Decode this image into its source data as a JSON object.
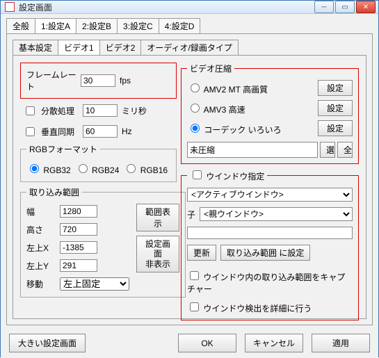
{
  "window": {
    "title": "設定画面"
  },
  "tabs1": {
    "items": [
      "全般",
      "1:設定A",
      "2:設定B",
      "3:設定C",
      "4:設定D"
    ],
    "active": 1
  },
  "tabs2": {
    "items": [
      "基本設定",
      "ビデオ1",
      "ビデオ2",
      "オーディオ/録画タイプ"
    ],
    "active": 1
  },
  "frame_rate": {
    "legend": "フレームレート",
    "value": "30",
    "unit": "fps",
    "distrib_label": "分散処理",
    "distrib_value": "10",
    "distrib_unit": "ミリ秒",
    "vsync_label": "垂直同期",
    "vsync_value": "60",
    "vsync_unit": "Hz"
  },
  "rgb_format": {
    "legend": "RGBフォーマット",
    "options": [
      "RGB32",
      "RGB24",
      "RGB16"
    ],
    "selected": 0
  },
  "capture_range": {
    "legend": "取り込み範囲",
    "width_label": "幅",
    "width_value": "1280",
    "height_label": "高さ",
    "height_value": "720",
    "left_label": "左上X",
    "left_value": "-1385",
    "top_label": "左上Y",
    "top_value": "291",
    "move_label": "移動",
    "move_value": "左上固定",
    "show_range_btn": "範囲表示",
    "hide_cfg_btn": "設定画面\n非表示"
  },
  "video_codec": {
    "legend": "ビデオ圧縮",
    "option1": "AMV2 MT 高画質",
    "option2": "AMV3 高速",
    "option3": "コーデック いろいろ",
    "selected": 2,
    "settings_btn": "設定",
    "codec_value": "未圧縮",
    "sel_btn": "選",
    "all_btn": "全"
  },
  "window_spec": {
    "legend": "ウインドウ指定",
    "active_value": "<アクティブウインドウ>",
    "child_label": "子",
    "child_value": "<親ウインドウ>",
    "refresh_btn": "更新",
    "set_range_btn": "取り込み範囲 に設定",
    "chk1": "ウインドウ内の取り込み範囲をキャプチャー",
    "chk2": "ウインドウ検出を詳細に行う"
  },
  "bottom_bar": {
    "big_btn": "大きい設定画面",
    "ok": "OK",
    "cancel": "キャンセル",
    "apply": "適用"
  }
}
